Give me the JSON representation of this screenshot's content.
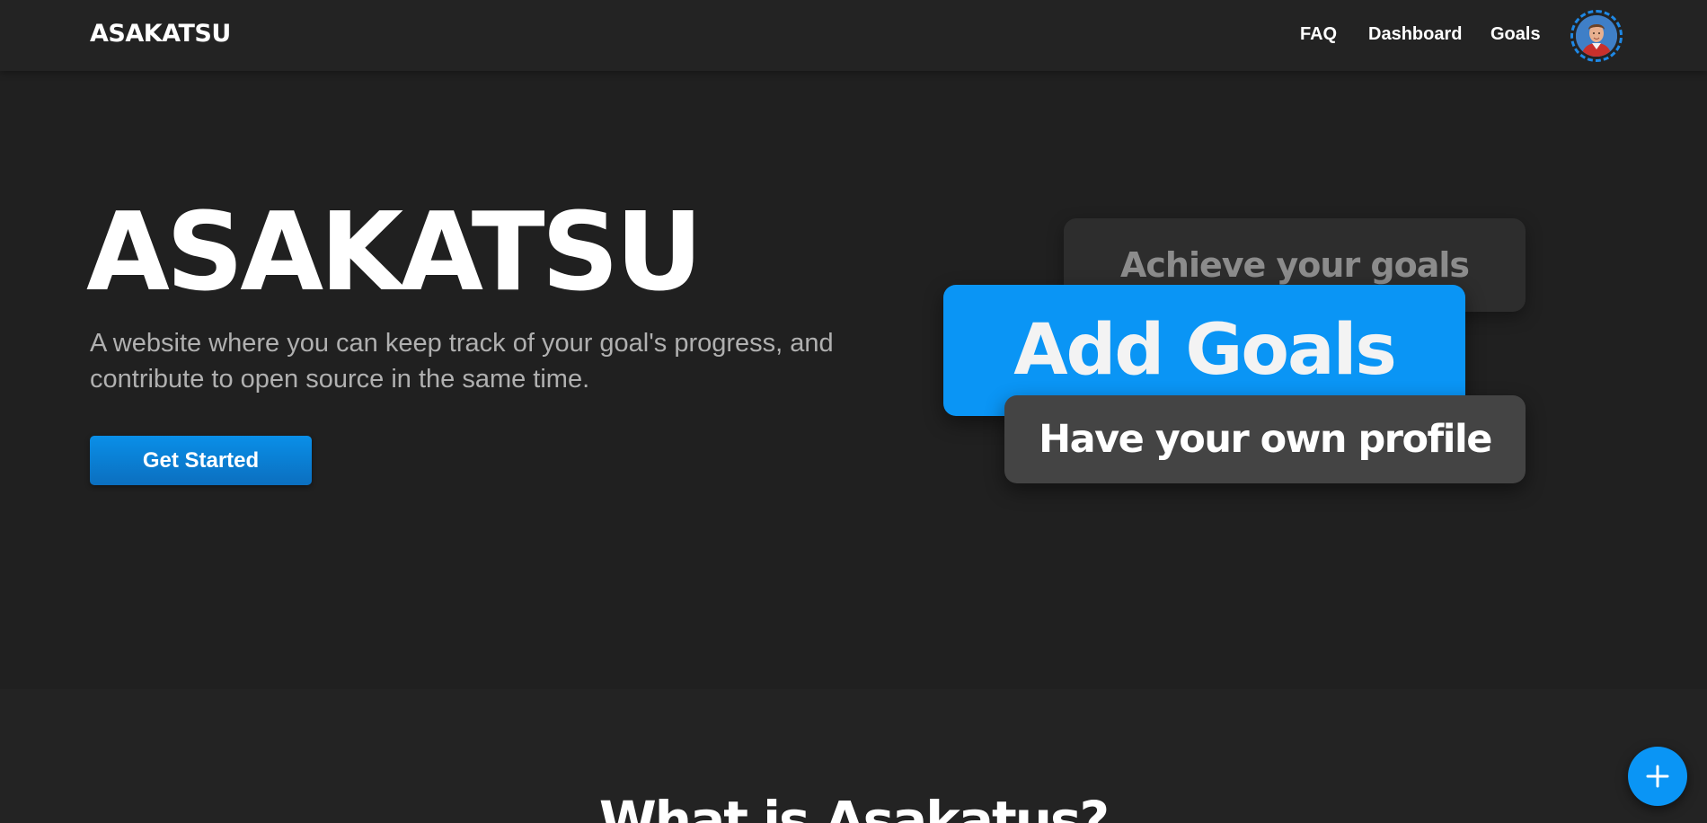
{
  "navbar": {
    "brand": "ASAKATSU",
    "links": {
      "faq": "FAQ",
      "dashboard": "Dashboard",
      "goals": "Goals"
    }
  },
  "hero": {
    "title": "ASAKATSU",
    "description": "A website where you can keep track of your goal's progress, and contribute to open source in the same time.",
    "cta_label": "Get Started"
  },
  "feature_cards": {
    "achieve": "Achieve your goals",
    "add": "Add Goals",
    "profile": "Have your own profile"
  },
  "section": {
    "heading": "What is Asakatus?"
  },
  "icons": {
    "avatar": "user-avatar",
    "fab": "plus-icon"
  },
  "colors": {
    "background": "#202020",
    "navbar": "#232323",
    "accent": "#0a95f5",
    "card_dark": "#2d2d2d",
    "card_gray": "#444444"
  }
}
